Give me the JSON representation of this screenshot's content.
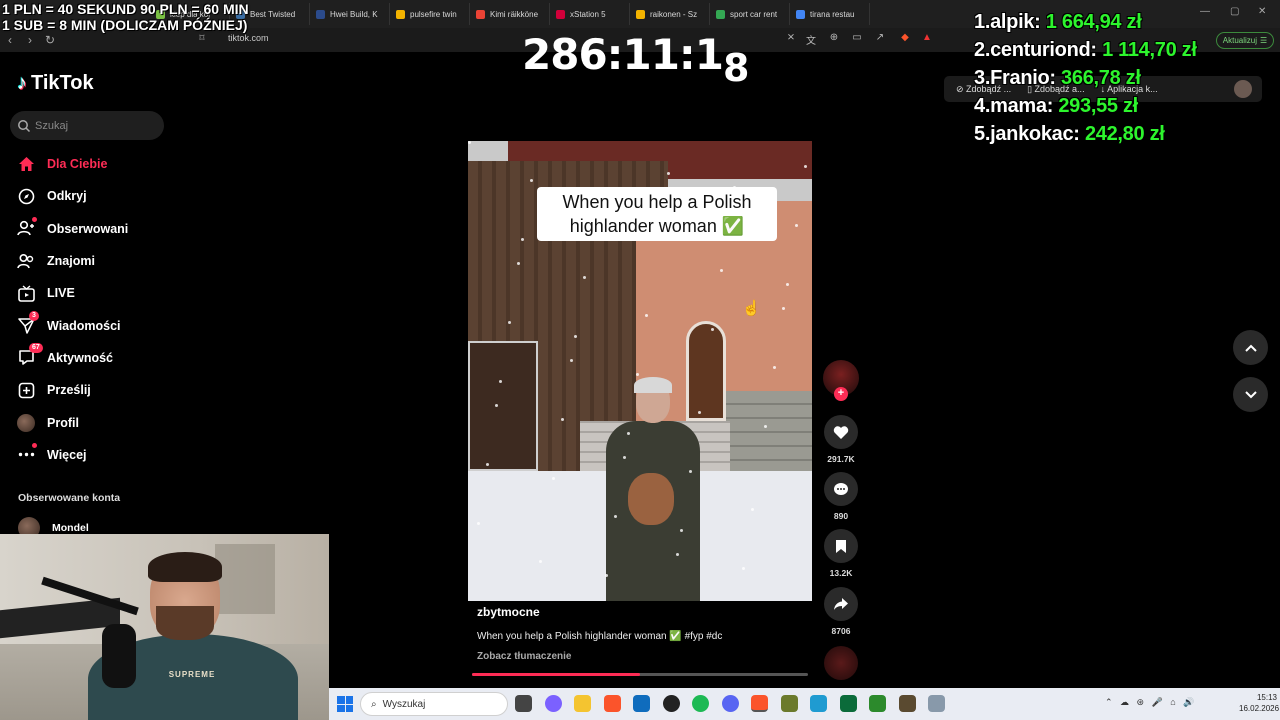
{
  "browser": {
    "tabs": [
      {
        "label": "klep dla kol",
        "color": "#7ac143"
      },
      {
        "label": "Best Twisted",
        "color": "#3a6ea5"
      },
      {
        "label": "Hwei Build, K",
        "color": "#2b4b8c"
      },
      {
        "label": "pulsefire twin",
        "color": "#f4b400"
      },
      {
        "label": "Kimi räikköne",
        "color": "#ea4335"
      },
      {
        "label": "xStation 5",
        "color": "#d1003a"
      },
      {
        "label": "raikonen - Sz",
        "color": "#f4b400"
      },
      {
        "label": "sport car rent",
        "color": "#34a853"
      },
      {
        "label": "tirana restau",
        "color": "#4285f4"
      }
    ],
    "url": "tiktok.com",
    "update_label": "Aktualizuj"
  },
  "stream_overlay": {
    "donate_line1": "1 PLN = 40 SEKUND 90 PLN = 60 MIN",
    "donate_line2": "1 SUB = 8 MIN (DOLICZAM PÓŹNIEJ)",
    "timer_main": "286:11:1",
    "timer_last": "8",
    "leaderboard": [
      {
        "rank": "1.",
        "name": "alpik:",
        "amount": "1 664,94 zł"
      },
      {
        "rank": "2.",
        "name": "centuriond:",
        "amount": "1 114,70 zł"
      },
      {
        "rank": "3.",
        "name": "Franio:",
        "amount": "366,78 zł"
      },
      {
        "rank": "4.",
        "name": "mama:",
        "amount": "293,55 zł"
      },
      {
        "rank": "5.",
        "name": "jankokac:",
        "amount": "242,80 zł"
      }
    ]
  },
  "bookmarks": [
    "Zdobądź ...",
    "Zdobądź a...",
    "Aplikacja k..."
  ],
  "tiktok": {
    "logo": "TikTok",
    "search_placeholder": "Szukaj",
    "nav": [
      {
        "label": "Dla Ciebie",
        "icon": "home-icon",
        "active": true
      },
      {
        "label": "Odkryj",
        "icon": "compass-icon"
      },
      {
        "label": "Obserwowani",
        "icon": "following-icon"
      },
      {
        "label": "Znajomi",
        "icon": "friends-icon"
      },
      {
        "label": "LIVE",
        "icon": "live-icon"
      },
      {
        "label": "Wiadomości",
        "icon": "messages-icon",
        "badge": "3"
      },
      {
        "label": "Aktywność",
        "icon": "activity-icon",
        "badge": "67"
      },
      {
        "label": "Prześlij",
        "icon": "upload-icon"
      },
      {
        "label": "Profil",
        "icon": "profile-avatar"
      },
      {
        "label": "Więcej",
        "icon": "more-icon"
      }
    ],
    "followed_title": "Obserwowane konta",
    "followed": [
      {
        "name": "Mondel"
      }
    ],
    "video": {
      "caption_overlay": "When you help a Polish highlander woman ✅",
      "author": "zbytmocne",
      "description": "When you help a Polish highlander woman ✅ #fyp #dc",
      "translate": "Zobacz tłumaczenie",
      "progress": 0.5
    },
    "actions": {
      "likes": "291.7K",
      "comments": "890",
      "saves": "13.2K",
      "shares": "8706"
    }
  },
  "webcam": {
    "sweater_text": "SUPREME"
  },
  "taskbar": {
    "search_placeholder": "Wyszukaj",
    "time": "15:13",
    "date": "16.02.2026"
  }
}
